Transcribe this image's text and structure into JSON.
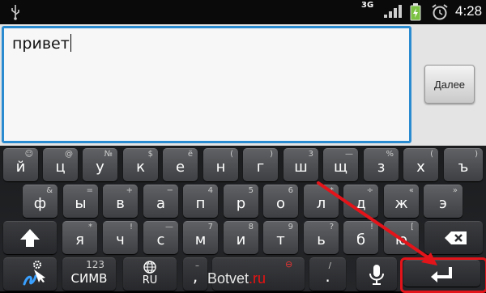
{
  "status_bar": {
    "network": "3G",
    "time": "4:28",
    "icons": [
      "usb-icon",
      "signal-icon",
      "battery-charging-icon",
      "alarm-icon"
    ]
  },
  "editor": {
    "text_value": "привет",
    "done_button": "Далее"
  },
  "keyboard": {
    "row1": [
      {
        "main": "й",
        "alt": "☺"
      },
      {
        "main": "ц",
        "alt": "@"
      },
      {
        "main": "у",
        "alt": "№"
      },
      {
        "main": "к",
        "alt": "$"
      },
      {
        "main": "е",
        "alt": "ё"
      },
      {
        "main": "н",
        "alt": "("
      },
      {
        "main": "г",
        "alt": ")"
      },
      {
        "main": "ш",
        "alt": "3"
      },
      {
        "main": "щ",
        "alt": "—"
      },
      {
        "main": "з",
        "alt": "%"
      },
      {
        "main": "х",
        "alt": "("
      },
      {
        "main": "ъ",
        "alt": ")"
      }
    ],
    "row2": [
      {
        "main": "ф",
        "alt": "&"
      },
      {
        "main": "ы",
        "alt": "="
      },
      {
        "main": "в",
        "alt": "+"
      },
      {
        "main": "а",
        "alt": "−"
      },
      {
        "main": "п",
        "alt": "4"
      },
      {
        "main": "р",
        "alt": "5"
      },
      {
        "main": "о",
        "alt": "6"
      },
      {
        "main": "л",
        "alt": "*"
      },
      {
        "main": "д",
        "alt": "÷"
      },
      {
        "main": "ж",
        "alt": "«"
      },
      {
        "main": "э",
        "alt": "»"
      }
    ],
    "row3": [
      {
        "main": "я",
        "alt": "*"
      },
      {
        "main": "ч",
        "alt": "!"
      },
      {
        "main": "с",
        "alt": "—"
      },
      {
        "main": "м",
        "alt": "7"
      },
      {
        "main": "и",
        "alt": "8"
      },
      {
        "main": "т",
        "alt": "9"
      },
      {
        "main": "ь",
        "alt": "?"
      },
      {
        "main": "б",
        "alt": "!"
      },
      {
        "main": "ю",
        "alt": "["
      }
    ],
    "symbols_key": {
      "top": "123",
      "label": "СИМВ"
    },
    "lang_key": "RU",
    "comma_key": ",",
    "comma_alt": "–",
    "period_key": ".",
    "period_alt": "/",
    "enter_icon": "enter-icon",
    "highlight_color": "#e3141a",
    "accent_color": "#2a8bd0"
  },
  "watermark": {
    "prefix": "Botvet",
    "suffix": ".ru",
    "badge": "⊖"
  }
}
